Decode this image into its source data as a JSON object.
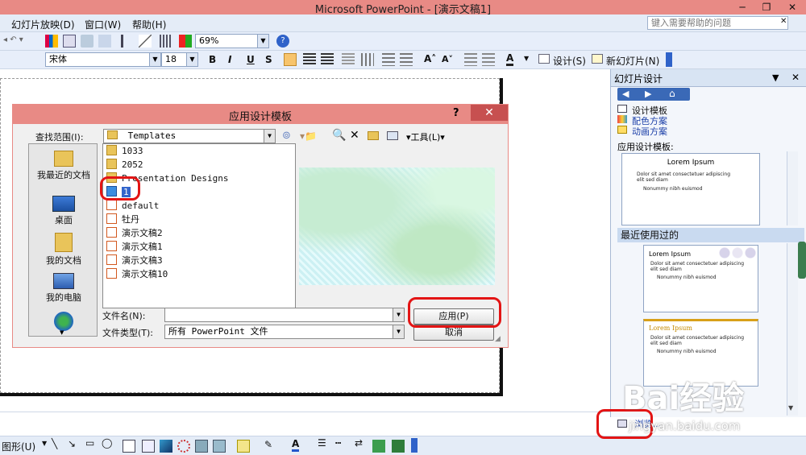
{
  "window": {
    "title": "Microsoft PowerPoint - [演示文稿1]",
    "min": "─",
    "restore": "❐",
    "close": "✕"
  },
  "menu": {
    "items": [
      "幻灯片放映(D)",
      "窗口(W)",
      "帮助(H)"
    ],
    "help_placeholder": "键入需要帮助的问题"
  },
  "toolbar1": {
    "zoom": "69%"
  },
  "toolbar2": {
    "font": "宋体",
    "size": "18",
    "bold": "B",
    "italic": "I",
    "underline": "U",
    "shadow": "S",
    "design_label": "设计(S)",
    "new_slide_label": "新幻灯片(N)"
  },
  "task_pane": {
    "title": "幻灯片设计",
    "links": [
      "设计模板",
      "配色方案",
      "动画方案"
    ],
    "apply_label": "应用设计模板:",
    "recent_label": "最近使用过的",
    "browse_label": "浏览...",
    "thumb_title": "Lorem Ipsum",
    "thumb_bullet": "Dolor sit amet consectetuer adipiscing elit sed diam",
    "thumb_sub": "Nonummy nibh euismod"
  },
  "dialog": {
    "title": "应用设计模板",
    "help": "?",
    "close": "✕",
    "look_in_label": "查找范围(I):",
    "look_in_value": "Templates",
    "tools_label": "工具(L)",
    "places": [
      "我最近的文档",
      "桌面",
      "我的文档",
      "我的电脑"
    ],
    "files": [
      {
        "name": "1033",
        "type": "folder"
      },
      {
        "name": "2052",
        "type": "folder"
      },
      {
        "name": "Presentation Designs",
        "type": "folder"
      },
      {
        "name": "1",
        "type": "template",
        "selected": true
      },
      {
        "name": "default",
        "type": "ppt"
      },
      {
        "name": "牡丹",
        "type": "ppt"
      },
      {
        "name": "演示文稿2",
        "type": "ppt"
      },
      {
        "name": "演示文稿1",
        "type": "ppt"
      },
      {
        "name": "演示文稿3",
        "type": "ppt"
      },
      {
        "name": "演示文稿10",
        "type": "ppt"
      }
    ],
    "filename_label": "文件名(N):",
    "filename_value": "",
    "filetype_label": "文件类型(T):",
    "filetype_value": "所有 PowerPoint 文件",
    "apply_button": "应用(P)",
    "cancel_button": "取消"
  },
  "drawbar": {
    "shapes_label": "图形(U)"
  },
  "watermark": {
    "brand": "Bai经验",
    "url": "jingyan.baidu.com"
  },
  "colors": {
    "titlebar": "#e88a85",
    "highlight": "#e31414",
    "preview": "#d8f4f7"
  }
}
